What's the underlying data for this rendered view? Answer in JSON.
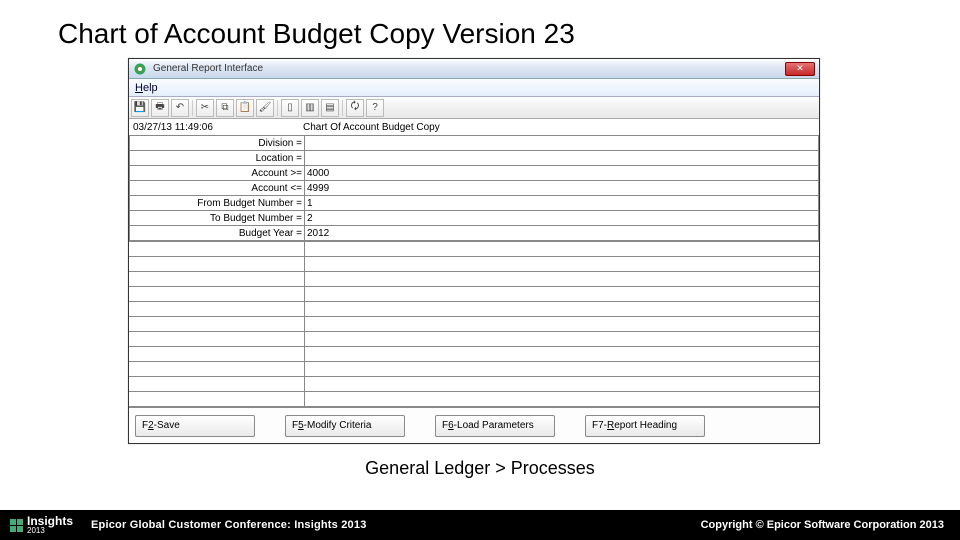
{
  "slide": {
    "title": "Chart of Account Budget Copy Version 23",
    "breadcrumb": "General Ledger > Processes"
  },
  "window": {
    "title": "General Report Interface",
    "menu": {
      "help": "Help"
    },
    "timestamp": "03/27/13 11:49:06",
    "form_title": "Chart Of Account Budget Copy",
    "fields": [
      {
        "label": "Division =",
        "value": ""
      },
      {
        "label": "Location =",
        "value": ""
      },
      {
        "label": "Account >=",
        "value": "4000"
      },
      {
        "label": "Account <=",
        "value": "4999"
      },
      {
        "label": "From Budget Number =",
        "value": "1"
      },
      {
        "label": "To Budget Number =",
        "value": "2"
      },
      {
        "label": "Budget Year =",
        "value": "2012"
      }
    ],
    "fkeys": {
      "f2": "F2-Save",
      "f5": "F5-Modify Criteria",
      "f6": "F6-Load Parameters",
      "f7": "F7-Report Heading"
    }
  },
  "footer": {
    "brand": "Insights",
    "year": "2013",
    "conference": "Epicor Global Customer Conference: Insights 2013",
    "copyright": "Copyright © Epicor Software Corporation 2013"
  },
  "icons": {
    "app": "◎",
    "close": "✕",
    "save": "💾",
    "print": "🖶",
    "undo": "↶",
    "cut": "✂",
    "copy": "⧉",
    "paste": "📋",
    "brush": "🖌",
    "col1": "▯",
    "col2": "▥",
    "col3": "▤",
    "refresh": "🗘",
    "help": "?"
  }
}
